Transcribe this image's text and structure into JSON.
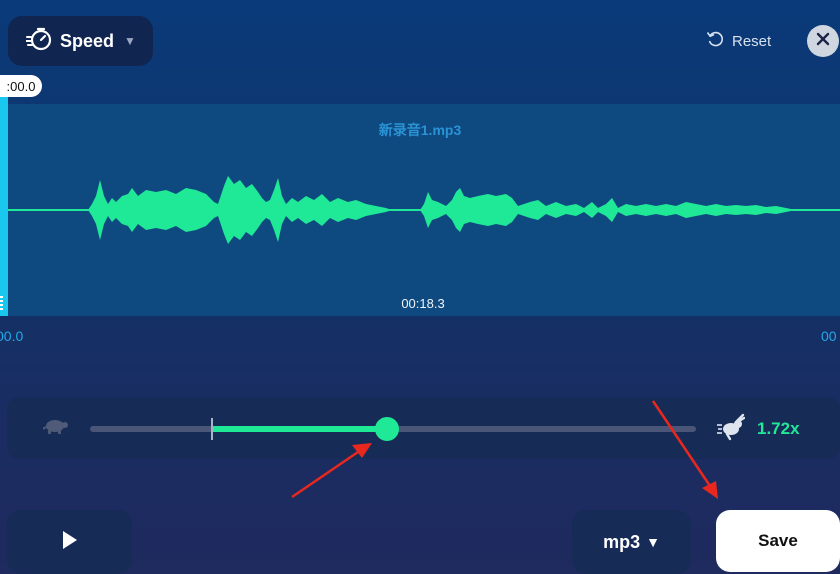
{
  "header": {
    "mode_label": "Speed",
    "mode_icon": "speed-stopwatch-icon",
    "reset_label": "Reset",
    "reset_icon": "undo-icon",
    "close_icon": "close-icon"
  },
  "waveform": {
    "file_name": "新录音1.mp3",
    "current_time": "00:18.3",
    "handle_time": ":00.0",
    "start_time": "00.0",
    "end_time": "00",
    "wave_color": "#1fe996"
  },
  "speed": {
    "slow_icon": "turtle-icon",
    "fast_icon": "rabbit-icon",
    "value_label": "1.72x",
    "value": 1.72,
    "accent": "#1fe996"
  },
  "footer": {
    "play_icon": "play-icon",
    "format_label": "mp3",
    "save_label": "Save"
  },
  "annotations": {
    "arrow_color": "#e8281e"
  }
}
